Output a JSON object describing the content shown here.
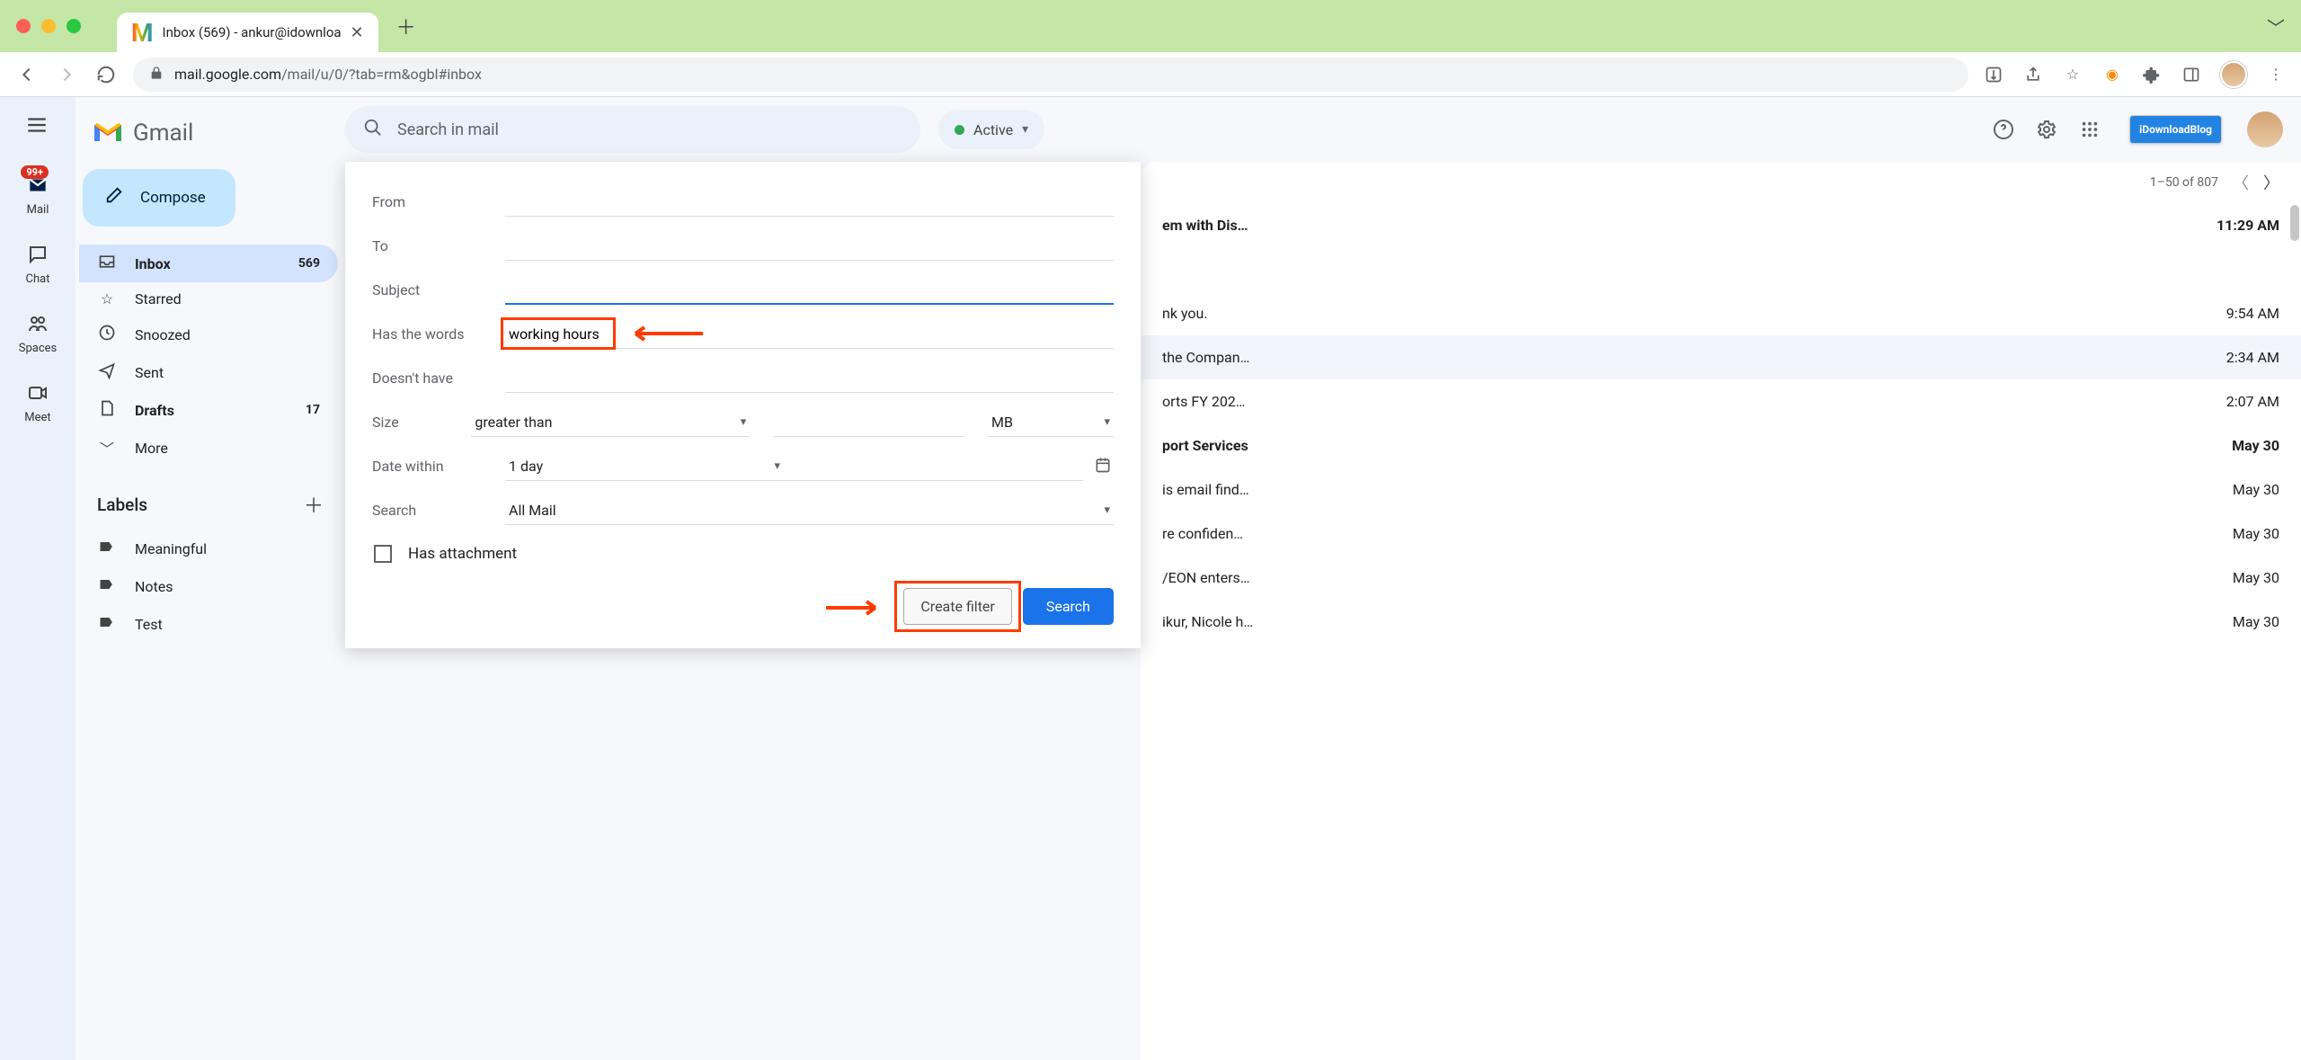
{
  "browser": {
    "tab_title": "Inbox (569) - ankur@idownloa",
    "url_domain": "mail.google.com",
    "url_path": "/mail/u/0/?tab=rm&ogbl#inbox"
  },
  "rail": {
    "mail": "Mail",
    "mail_badge": "99+",
    "chat": "Chat",
    "spaces": "Spaces",
    "meet": "Meet"
  },
  "sidebar": {
    "logo_text": "Gmail",
    "compose": "Compose",
    "items": [
      {
        "label": "Inbox",
        "count": "569"
      },
      {
        "label": "Starred"
      },
      {
        "label": "Snoozed"
      },
      {
        "label": "Sent"
      },
      {
        "label": "Drafts",
        "count": "17"
      },
      {
        "label": "More"
      }
    ],
    "labels_header": "Labels",
    "labels": [
      {
        "label": "Meaningful"
      },
      {
        "label": "Notes"
      },
      {
        "label": "Test"
      }
    ]
  },
  "topbar": {
    "search_placeholder": "Search in mail",
    "status": "Active",
    "brand_badge": "iDownloadBlog"
  },
  "filter": {
    "from": "From",
    "from_val": "",
    "to": "To",
    "to_val": "",
    "subject": "Subject",
    "subject_val": "",
    "has_words": "Has the words",
    "has_words_val": "working hours",
    "doesnt_have": "Doesn't have",
    "doesnt_have_val": "",
    "size": "Size",
    "size_op": "greater than",
    "size_unit": "MB",
    "date_within": "Date within",
    "date_val": "1 day",
    "search": "Search",
    "search_val": "All Mail",
    "has_attachment": "Has attachment",
    "create_filter": "Create filter",
    "search_btn": "Search"
  },
  "list": {
    "pagination": "1–50 of 807",
    "rows": [
      {
        "snip": "em with Dis…",
        "time": "11:29 AM",
        "unread": true
      },
      {
        "snip": "nk you.",
        "time": "9:54 AM",
        "unread": false
      },
      {
        "snip": "the Compan…",
        "time": "2:34 AM",
        "unread": false
      },
      {
        "snip": "orts FY 202…",
        "time": "2:07 AM",
        "unread": false
      },
      {
        "snip": "port Services",
        "time": "May 30",
        "unread": true
      },
      {
        "snip": "is email find…",
        "time": "May 30",
        "unread": false
      },
      {
        "snip": "re confiden…",
        "time": "May 30",
        "unread": false
      },
      {
        "snip": "/EON enters…",
        "time": "May 30",
        "unread": false
      },
      {
        "snip": "ikur, Nicole h…",
        "time": "May 30",
        "unread": false
      }
    ]
  }
}
